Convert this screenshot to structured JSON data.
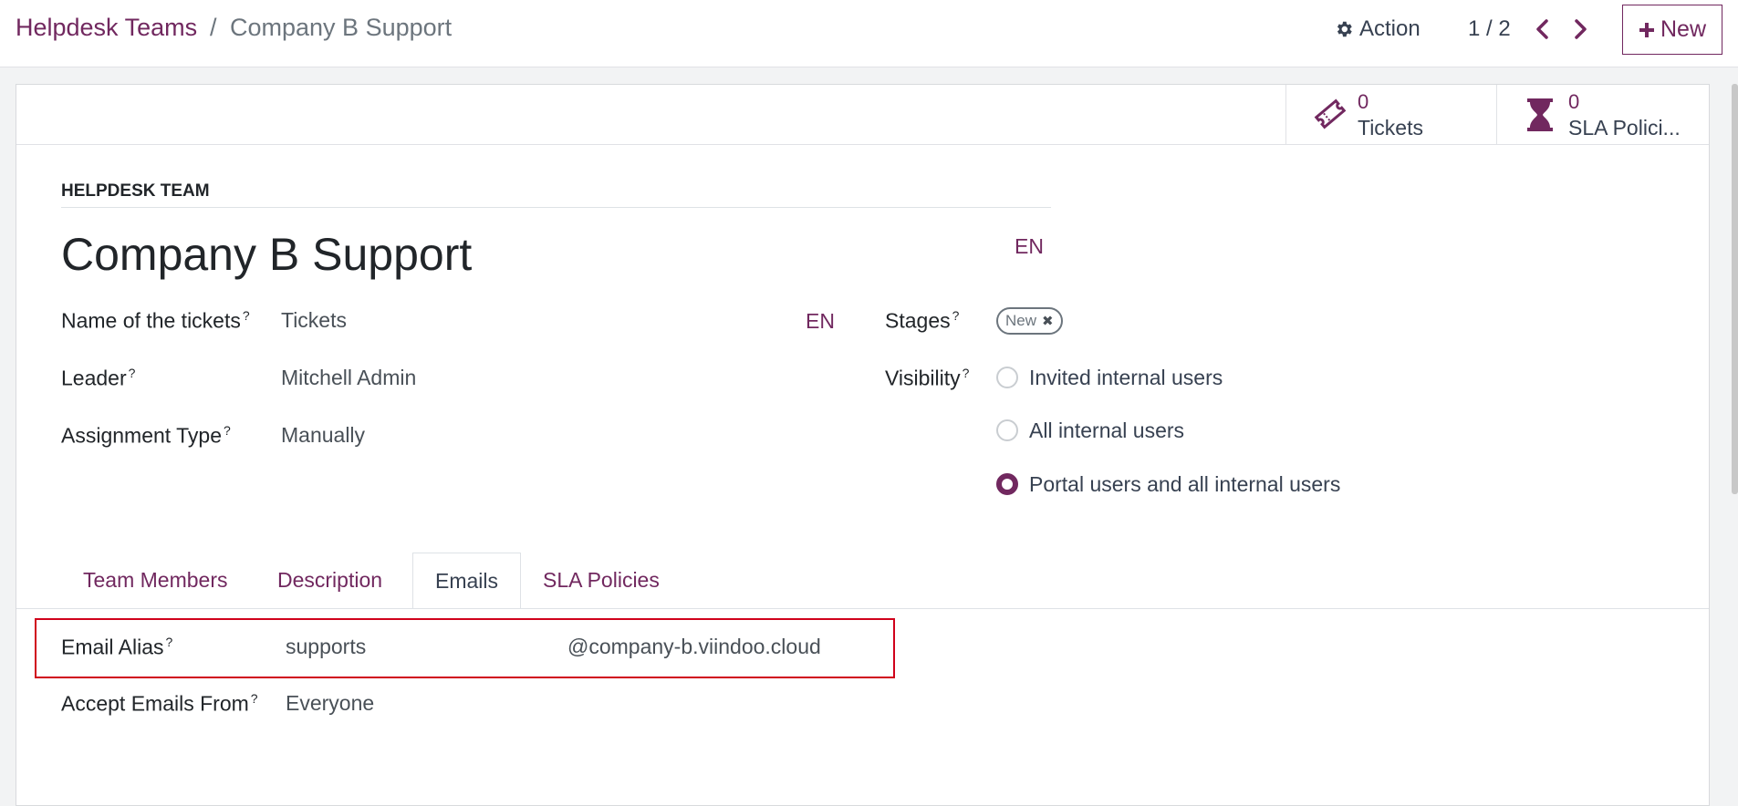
{
  "breadcrumb": {
    "parent": "Helpdesk Teams",
    "separator": "/",
    "current": "Company B Support"
  },
  "toolbar": {
    "action_label": "Action",
    "pager": "1 / 2",
    "new_label": "New"
  },
  "stat_buttons": {
    "tickets": {
      "value": "0",
      "label": "Tickets",
      "icon": "ticket-icon"
    },
    "sla": {
      "value": "0",
      "label": "SLA Polici...",
      "icon": "hourglass-icon"
    }
  },
  "form": {
    "section_title": "HELPDESK TEAM",
    "name": "Company B Support",
    "lang": "EN",
    "fields": {
      "ticket_name": {
        "label": "Name of the tickets",
        "value": "Tickets",
        "lang": "EN"
      },
      "leader": {
        "label": "Leader",
        "value": "Mitchell Admin"
      },
      "assignment": {
        "label": "Assignment Type",
        "value": "Manually"
      },
      "stages": {
        "label": "Stages",
        "tag": "New"
      },
      "visibility": {
        "label": "Visibility",
        "options": [
          "Invited internal users",
          "All internal users",
          "Portal users and all internal users"
        ],
        "selected_index": 2
      }
    },
    "help_mark": "?"
  },
  "tabs": {
    "team_members": "Team Members",
    "description": "Description",
    "emails": "Emails",
    "sla_policies": "SLA Policies",
    "active": "Emails"
  },
  "emails_tab": {
    "alias_label": "Email Alias",
    "alias_value": "supports",
    "alias_domain": "@company-b.viindoo.cloud",
    "accept_label": "Accept Emails From",
    "accept_value": "Everyone"
  },
  "colors": {
    "accent": "#71285f",
    "highlight_border": "#d0021b"
  }
}
